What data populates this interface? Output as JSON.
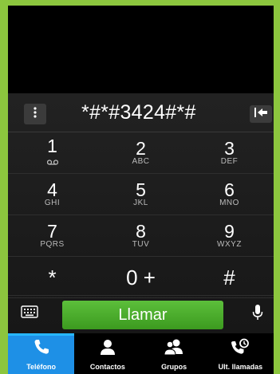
{
  "colors": {
    "accent": "#1e90e6",
    "call_green": "#4bb12b",
    "frame": "#8cc63e"
  },
  "display": {
    "number": "*#*#3424#*#"
  },
  "keypad": [
    [
      {
        "digit": "1",
        "letters": "",
        "icon": "voicemail-icon"
      },
      {
        "digit": "2",
        "letters": "ABC"
      },
      {
        "digit": "3",
        "letters": "DEF"
      }
    ],
    [
      {
        "digit": "4",
        "letters": "GHI"
      },
      {
        "digit": "5",
        "letters": "JKL"
      },
      {
        "digit": "6",
        "letters": "MNO"
      }
    ],
    [
      {
        "digit": "7",
        "letters": "PQRS"
      },
      {
        "digit": "8",
        "letters": "TUV"
      },
      {
        "digit": "9",
        "letters": "WXYZ"
      }
    ],
    [
      {
        "digit": "*",
        "letters": ""
      },
      {
        "digit": "0 +",
        "letters": ""
      },
      {
        "digit": "#",
        "letters": ""
      }
    ]
  ],
  "call_button": {
    "label": "Llamar"
  },
  "tabs": [
    {
      "label": "Teléfono",
      "icon": "phone-icon"
    },
    {
      "label": "Contactos",
      "icon": "person-icon"
    },
    {
      "label": "Grupos",
      "icon": "group-icon"
    },
    {
      "label": "Ult. llamadas",
      "icon": "recent-calls-icon"
    }
  ],
  "icons": [
    "overflow-menu-icon",
    "backspace-icon",
    "keyboard-icon",
    "microphone-icon"
  ]
}
